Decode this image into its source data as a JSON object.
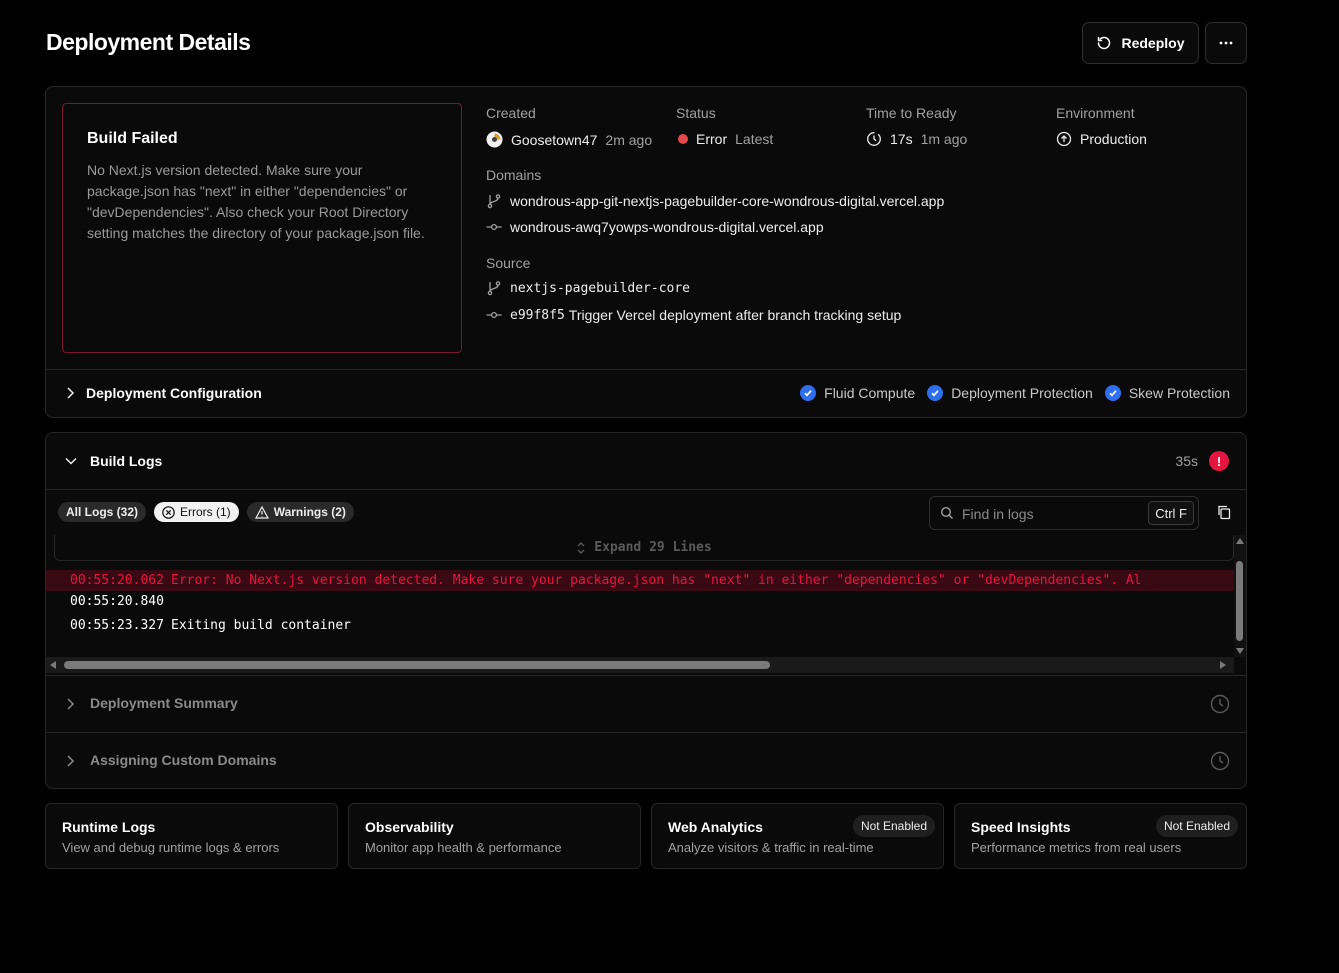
{
  "header": {
    "title": "Deployment Details",
    "redeploy_label": "Redeploy"
  },
  "summary": {
    "build_failed_title": "Build Failed",
    "build_failed_message": "No Next.js version detected. Make sure your package.json has \"next\" in either \"dependencies\" or \"devDependencies\". Also check your Root Directory setting matches the directory of your package.json file.",
    "created_label": "Created",
    "created_user": "Goosetown47",
    "created_time": "2m ago",
    "status_label": "Status",
    "status_value": "Error",
    "status_tag": "Latest",
    "time_label": "Time to Ready",
    "time_value": "17s",
    "time_ago": "1m ago",
    "env_label": "Environment",
    "env_value": "Production",
    "domains_label": "Domains",
    "domains": [
      "wondrous-app-git-nextjs-pagebuilder-core-wondrous-digital.vercel.app",
      "wondrous-awq7yowps-wondrous-digital.vercel.app"
    ],
    "source_label": "Source",
    "source_branch": "nextjs-pagebuilder-core",
    "source_commit_hash": "e99f8f5",
    "source_commit_msg": "Trigger Vercel deployment after branch tracking setup",
    "status_color": "#e5484d"
  },
  "config": {
    "title": "Deployment Configuration",
    "features": [
      "Fluid Compute",
      "Deployment Protection",
      "Skew Protection"
    ],
    "check_color": "#2f6fed"
  },
  "logs": {
    "title": "Build Logs",
    "duration": "35s",
    "alert_icon": "!",
    "filters": {
      "all": "All Logs (32)",
      "errors": "Errors (1)",
      "warnings": "Warnings (2)"
    },
    "search_placeholder": "Find in logs",
    "search_shortcut": "Ctrl F",
    "expand_label": "Expand 29 Lines",
    "lines": [
      {
        "time": "00:55:20.062",
        "text": "Error: No Next.js version detected. Make sure your package.json has \"next\" in either \"dependencies\" or \"devDependencies\". Al"
      },
      {
        "time": "00:55:20.840",
        "text": ""
      },
      {
        "time": "00:55:23.327",
        "text": "Exiting build container"
      }
    ],
    "error_color": "#e5153f"
  },
  "steps": {
    "summary": "Deployment Summary",
    "domains": "Assigning Custom Domains"
  },
  "cards": {
    "runtime": {
      "title": "Runtime Logs",
      "subtitle": "View and debug runtime logs & errors"
    },
    "observability": {
      "title": "Observability",
      "subtitle": "Monitor app health & performance"
    },
    "analytics": {
      "title": "Web Analytics",
      "subtitle": "Analyze visitors & traffic in real-time",
      "badge": "Not Enabled"
    },
    "speed": {
      "title": "Speed Insights",
      "subtitle": "Performance metrics from real users",
      "badge": "Not Enabled"
    }
  }
}
